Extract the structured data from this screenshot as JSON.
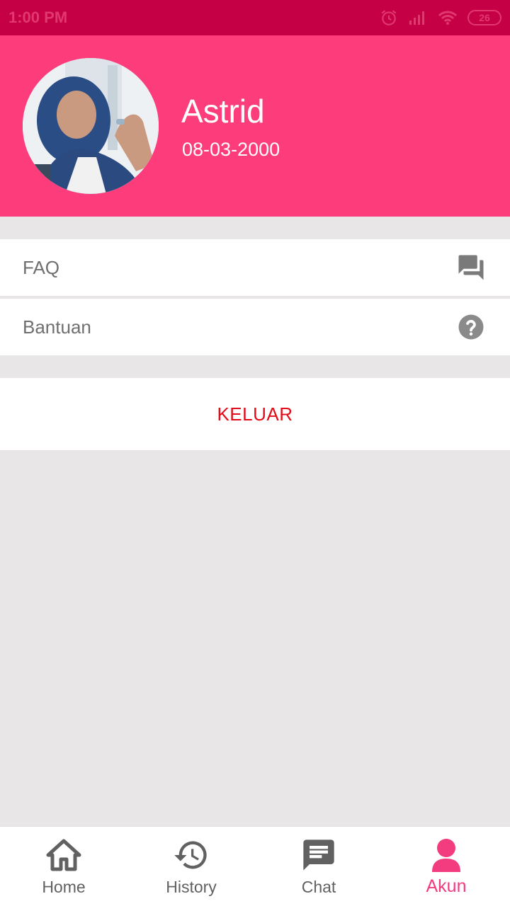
{
  "status_bar": {
    "time": "1:00 PM",
    "battery": "26",
    "icons": [
      "alarm-icon",
      "signal-icon",
      "wifi-icon",
      "battery-icon"
    ]
  },
  "profile": {
    "name": "Astrid",
    "dob": "08-03-2000"
  },
  "menu": {
    "items": [
      {
        "label": "FAQ",
        "icon": "forum-icon"
      },
      {
        "label": "Bantuan",
        "icon": "help-circle-icon"
      }
    ],
    "logout_label": "KELUAR"
  },
  "bottom_nav": {
    "tabs": [
      {
        "label": "Home",
        "icon": "home-icon",
        "active": false
      },
      {
        "label": "History",
        "icon": "history-icon",
        "active": false
      },
      {
        "label": "Chat",
        "icon": "chat-icon",
        "active": false
      },
      {
        "label": "Akun",
        "icon": "account-icon",
        "active": true
      }
    ]
  },
  "colors": {
    "status_bar": "#c50045",
    "header": "#fc3c7b",
    "accent": "#f33b80",
    "logout": "#e30b17",
    "background": "#e8e6e7"
  }
}
